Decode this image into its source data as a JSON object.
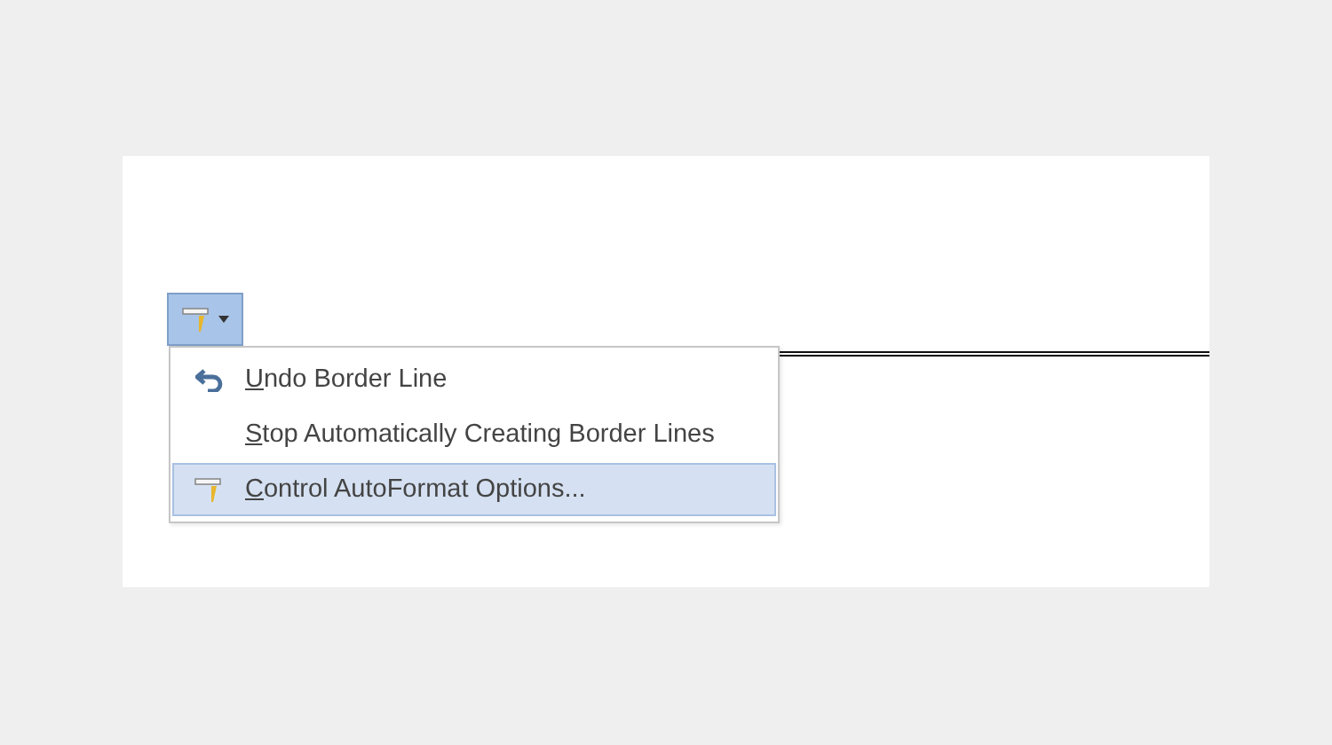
{
  "options_button": {
    "selected": true
  },
  "menu": {
    "items": [
      {
        "kind": "undo",
        "key": "U",
        "rest": "ndo Border Line",
        "selected": false
      },
      {
        "kind": "plain",
        "key": "S",
        "rest": "top Automatically Creating Border Lines",
        "selected": false
      },
      {
        "kind": "autoformat",
        "key": "C",
        "rest": "ontrol AutoFormat Options...",
        "selected": true
      }
    ]
  }
}
